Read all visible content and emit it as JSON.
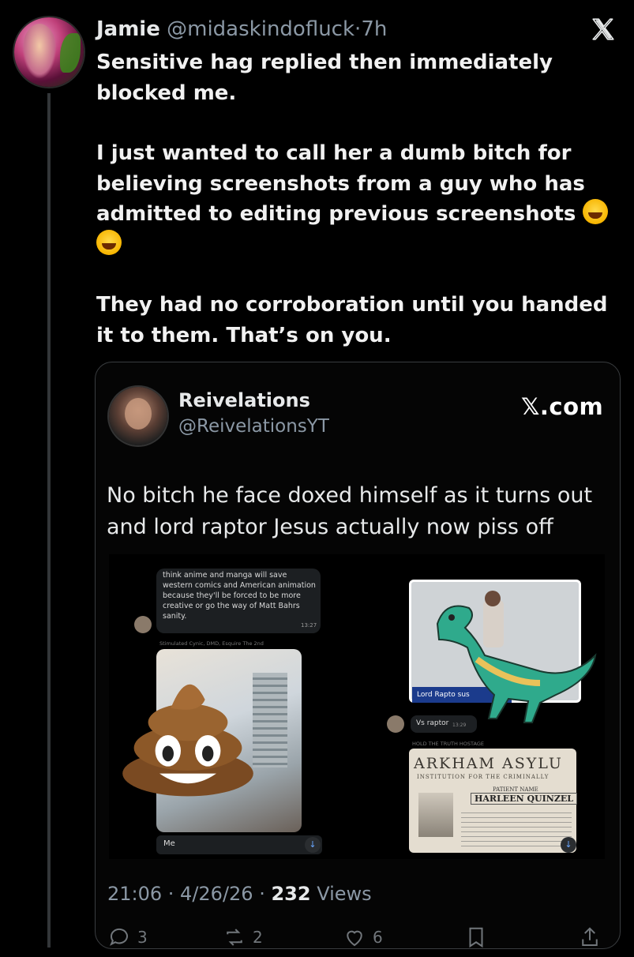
{
  "tweet": {
    "author_name": "Jamie",
    "handle": "@midaskindofluck",
    "separator": "·",
    "age": "7h",
    "paragraph_1": "Sensitive hag replied then immediately blocked me.",
    "paragraph_2": "I just wanted to call her a dumb bitch for believing screenshots from a guy who has admitted to editing previous screenshots",
    "paragraph_3": "They had no corroboration until you handed it to them. That’s on you.",
    "emoji_name": "rolling-on-floor-laughing-emoji"
  },
  "quoted": {
    "author_name": "Reivelations",
    "handle": "@ReivelationsYT",
    "brand": "𝕏.com",
    "text": "No bitch he face doxed himself as it turns out and lord raptor Jesus actually now piss off",
    "media": {
      "chat_text": "think anime and manga will save western comics and American animation because they'll be forced to be more creative or go the way of Matt Bahrs sanity.",
      "chat_time": "13:27",
      "sender_meta": "Stimulated Cynic, DMD, Esquire The 2nd",
      "me_label": "Me",
      "video_label": "Lord Rapto    sus",
      "vs_text": "Vs raptor",
      "vs_time": "13:29",
      "hold_meta": "HOLD THE TRUTH HOSTAGE",
      "arkham_title": "ARKHAM ASYLU",
      "arkham_sub": "INSTITUTION FOR THE CRIMINALLY",
      "arkham_patient_label": "PATIENT NAME",
      "arkham_patient_name": "HARLEEN QUINZEL"
    },
    "timestamp": "21:06 · 4/26/26 · ",
    "views_count": "232",
    "views_label": " Views",
    "actions": {
      "replies": "3",
      "reposts": "2",
      "likes": "6"
    }
  },
  "colors": {
    "background": "#000000",
    "text": "#e7e9ea",
    "muted": "#8b98a5",
    "border": "#3a3d40"
  }
}
